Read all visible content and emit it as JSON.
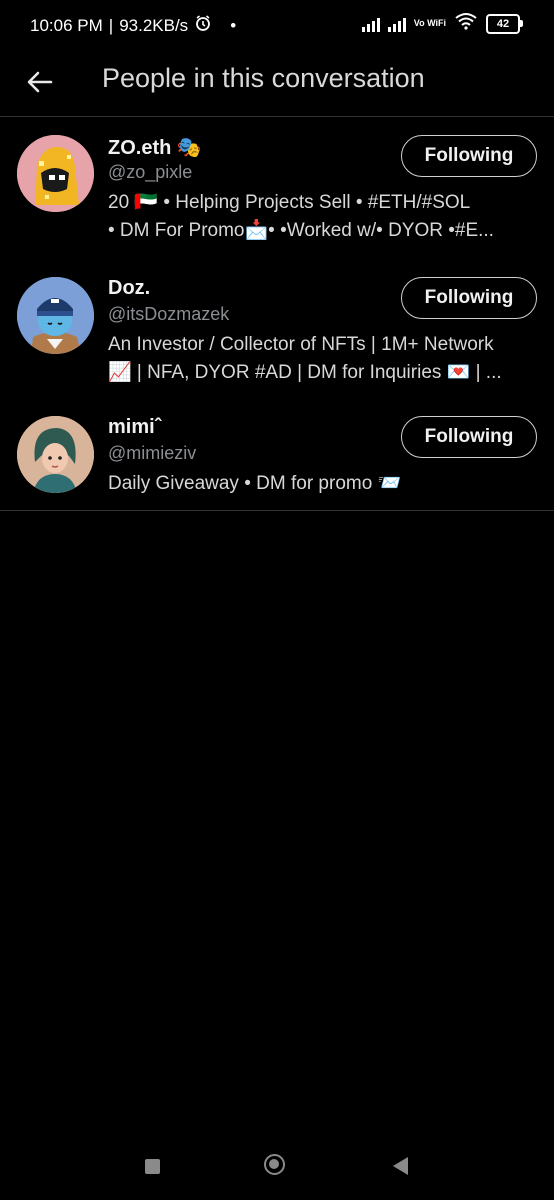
{
  "status_bar": {
    "time": "10:06 PM",
    "speed": "93.2KB/s",
    "network_label": "Vo WiFi",
    "battery": "42"
  },
  "header": {
    "title": "People in this conversation"
  },
  "users": [
    {
      "name": "ZO.eth",
      "name_emoji": "🎭",
      "handle": "@zo_pixle",
      "bio_lines": [
        "20 🇦🇪 • Helping Projects Sell • #ETH/#SOL",
        "• DM For Promo📩• •Worked w/• DYOR •#E..."
      ],
      "button": "Following"
    },
    {
      "name": "Doz.",
      "handle": "@itsDozmazek",
      "bio_lines": [
        "An Investor / Collector of NFTs | 1M+ Network",
        "📈 | NFA, DYOR #AD | DM for Inquiries 💌 | ..."
      ],
      "button": "Following"
    },
    {
      "name": "mimiˆ",
      "handle": "@mimieziv",
      "bio_lines": [
        "Daily Giveaway • DM for promo 📨"
      ],
      "button": "Following"
    }
  ],
  "colors": {
    "background": "#000000",
    "text_primary": "#e7e9ea",
    "text_secondary": "#8b8f93",
    "divider": "#2f3336"
  }
}
